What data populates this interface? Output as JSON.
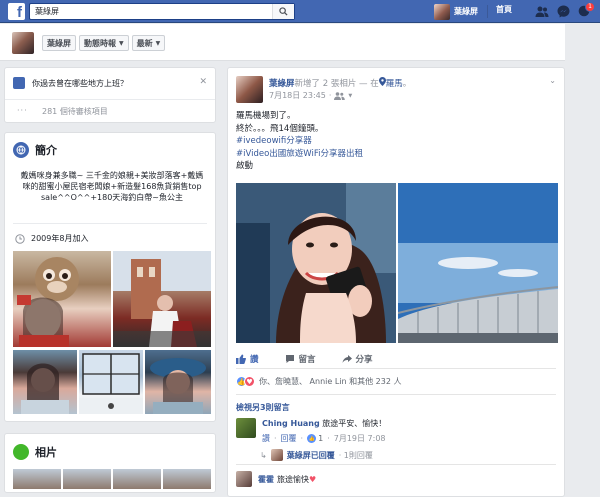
{
  "topbar": {
    "logo": "f",
    "search_value": "葉綠屏",
    "user_name": "葉綠屏",
    "home_label": "首頁",
    "notification_count": "1"
  },
  "profile_bar": {
    "name_button": "葉綠屏",
    "timeline_button": "動態時報",
    "latest_button": "最新"
  },
  "workplace_card": {
    "question": "你過去曾在哪些地方上班？",
    "pending_count": "281 個待審核項目"
  },
  "intro_card": {
    "heading": "簡介",
    "bio": "戴媽咪身兼多職~ 三千金的娘親+美妝部落客+戴媽咪的甜蜜小屋民宿老闆娘+新造髮168魚貨銷售top sale^^O^^+180天海釣白帶~魚公主",
    "joined": "2009年8月加入"
  },
  "photos_card": {
    "heading": "相片"
  },
  "post": {
    "author": "葉綠屏",
    "action": "新增了 2 張相片",
    "location_prefix": " — 在",
    "location": "羅馬",
    "time": "7月18日 23:45",
    "text_lines": [
      "羅馬機場到了。",
      "終於。。。飛14個鐘頭。"
    ],
    "hashtag1": "#ivedeowifi分享器",
    "hashtag2": "#iVideo出國旅遊WiFi分享器出租",
    "text_last": "啟動",
    "like_label": "讚",
    "comment_label": "留言",
    "share_label": "分享",
    "likes_summary": "你、詹曉慧、 Annie Lin 和其他 232 人",
    "view_more": "檢視另3則留言",
    "comment1": {
      "author": "Ching Huang",
      "text": "旅途平安、愉快！",
      "like": "讚",
      "reply": "回覆",
      "like_count": "1",
      "time": "7月19日 7:08"
    },
    "reply_summary": {
      "name": "葉綠屏已回覆",
      "count": "· 1則回覆"
    },
    "comment2": {
      "author": "霍霍",
      "text": "旅途愉快"
    }
  }
}
